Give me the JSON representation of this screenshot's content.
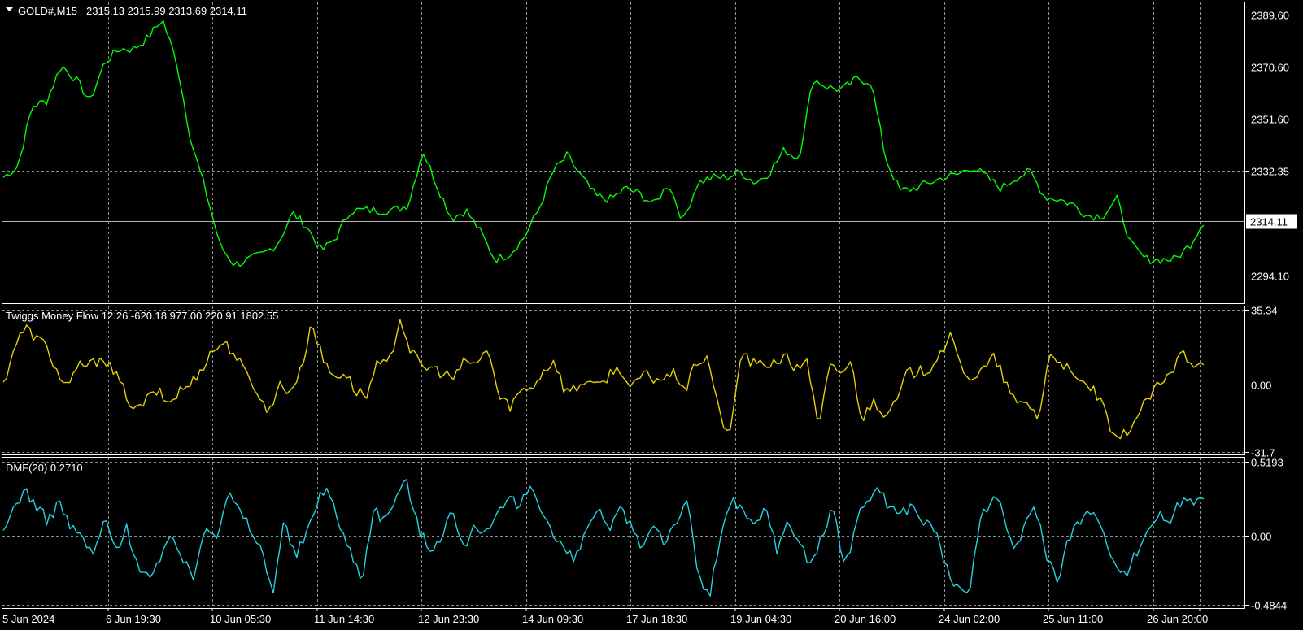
{
  "symbol": {
    "title": "GOLD#,M15",
    "ohlc": "2315.13 2315.99 2313.69 2314.11"
  },
  "chart_data": [
    {
      "type": "line",
      "title": "GOLD#,M15  2315.13 2315.99 2313.69 2314.11",
      "ylim": [
        2284,
        2394
      ],
      "y_ticks": [
        "2389.60",
        "2370.60",
        "2351.60",
        "2332.35",
        "2294.10"
      ],
      "y_tick_values": [
        2389.6,
        2370.6,
        2351.6,
        2332.35,
        2294.1
      ],
      "current_price_label": "2314.11",
      "current_price": 2314.11,
      "grid": true,
      "colors": {
        "series": "#00ff00",
        "current_line": "#b5b5b5",
        "grid": "#8f8f8f",
        "frame": "#ffffff"
      },
      "series": [
        {
          "values": [
            2330,
            2334,
            2356,
            2358,
            2371,
            2366,
            2358,
            2372,
            2377,
            2377,
            2381,
            2388,
            2372,
            2343,
            2325,
            2305,
            2298,
            2300,
            2302,
            2306,
            2317,
            2312,
            2303,
            2308,
            2318,
            2318,
            2318,
            2318,
            2320,
            2340,
            2327,
            2315,
            2318,
            2310,
            2300,
            2302,
            2308,
            2318,
            2332,
            2338,
            2330,
            2323,
            2322,
            2326,
            2324,
            2320,
            2328,
            2314,
            2328,
            2330,
            2330,
            2332,
            2328,
            2332,
            2340,
            2337,
            2366,
            2363,
            2362,
            2366,
            2365,
            2337,
            2325,
            2326,
            2328,
            2330,
            2331,
            2334,
            2330,
            2326,
            2330,
            2332,
            2323,
            2322,
            2320,
            2316,
            2316,
            2322,
            2305,
            2300,
            2300,
            2300,
            2305,
            2314
          ]
        }
      ]
    },
    {
      "type": "line",
      "title": "Twiggs Money Flow 12.26 -620.18 977.00 220.91 1802.55",
      "ylim": [
        -33,
        37
      ],
      "y_ticks": [
        "35.34",
        "0.00",
        "-31.7"
      ],
      "y_tick_values": [
        35.34,
        0.0,
        -31.7
      ],
      "grid": true,
      "colors": {
        "series": "#e6d200"
      },
      "series": [
        {
          "values": [
            0,
            18,
            27,
            22,
            18,
            4,
            -1,
            10,
            9,
            14,
            6,
            -3,
            -13,
            -7,
            -3,
            -9,
            -3,
            0,
            8,
            16,
            20,
            15,
            5,
            -2,
            -14,
            0,
            -3,
            6,
            30,
            12,
            4,
            6,
            -3,
            -5,
            10,
            9,
            32,
            16,
            8,
            8,
            5,
            3,
            12,
            9,
            18,
            -6,
            -10,
            -3,
            -1,
            6,
            12,
            -3,
            -2,
            3,
            -2,
            5,
            8,
            -3,
            5,
            3,
            3,
            5,
            -2,
            11,
            13,
            -14,
            -24,
            16,
            10,
            9,
            11,
            13,
            7,
            13,
            -22,
            8,
            6,
            10,
            -17,
            -7,
            -13,
            -10,
            5,
            6,
            7,
            15,
            22,
            8,
            3,
            7,
            13,
            1,
            -10,
            -8,
            -16,
            14,
            12,
            4,
            0,
            -2,
            -13,
            -28,
            -22,
            -15,
            -6,
            0,
            4,
            16,
            10,
            12
          ]
        }
      ]
    },
    {
      "type": "line",
      "title": "DMF(20) 0.2710",
      "ylim": [
        -0.51,
        0.55
      ],
      "y_ticks": [
        "0.5193",
        "0.00",
        "-0.4844"
      ],
      "y_tick_values": [
        0.5193,
        0.0,
        -0.4844
      ],
      "grid": true,
      "colors": {
        "series": "#22d4e0"
      },
      "series": [
        {
          "values": [
            0,
            0.22,
            0.32,
            0.2,
            0.1,
            0.25,
            0.05,
            0.0,
            -0.15,
            0.12,
            -0.1,
            0.05,
            -0.2,
            -0.3,
            -0.2,
            0.05,
            -0.18,
            -0.3,
            0.1,
            0.0,
            0.3,
            0.18,
            0.05,
            -0.1,
            -0.4,
            0.1,
            -0.15,
            0.0,
            0.25,
            0.35,
            0.05,
            -0.12,
            -0.3,
            0.2,
            0.1,
            0.28,
            0.38,
            0.05,
            -0.1,
            0.0,
            0.18,
            -0.1,
            0.1,
            0.0,
            0.12,
            0.26,
            0.2,
            0.36,
            0.2,
            0.0,
            -0.1,
            -0.18,
            0.05,
            0.2,
            0.0,
            0.2,
            0.05,
            -0.08,
            0.1,
            -0.05,
            0.12,
            0.22,
            -0.3,
            -0.42,
            0.05,
            0.25,
            0.15,
            0.06,
            0.2,
            -0.1,
            0.1,
            -0.05,
            -0.2,
            0.0,
            0.2,
            -0.25,
            0.1,
            0.25,
            0.35,
            0.2,
            0.15,
            0.22,
            0.1,
            0.05,
            -0.2,
            -0.38,
            -0.45,
            0.1,
            0.25,
            0.2,
            -0.1,
            0.05,
            0.22,
            -0.15,
            -0.3,
            0.0,
            0.1,
            0.2,
            0.0,
            -0.15,
            -0.28,
            -0.12,
            0.05,
            0.15,
            0.1,
            0.25,
            0.25,
            0.3
          ]
        }
      ]
    }
  ],
  "time_axis": {
    "labels": [
      "5 Jun 2024",
      "6 Jun 19:30",
      "10 Jun 05:30",
      "11 Jun 14:30",
      "12 Jun 23:30",
      "14 Jun 09:30",
      "17 Jun 18:30",
      "19 Jun 04:30",
      "20 Jun 16:00",
      "24 Jun 02:00",
      "25 Jun 11:00",
      "26 Jun 20:00"
    ]
  }
}
